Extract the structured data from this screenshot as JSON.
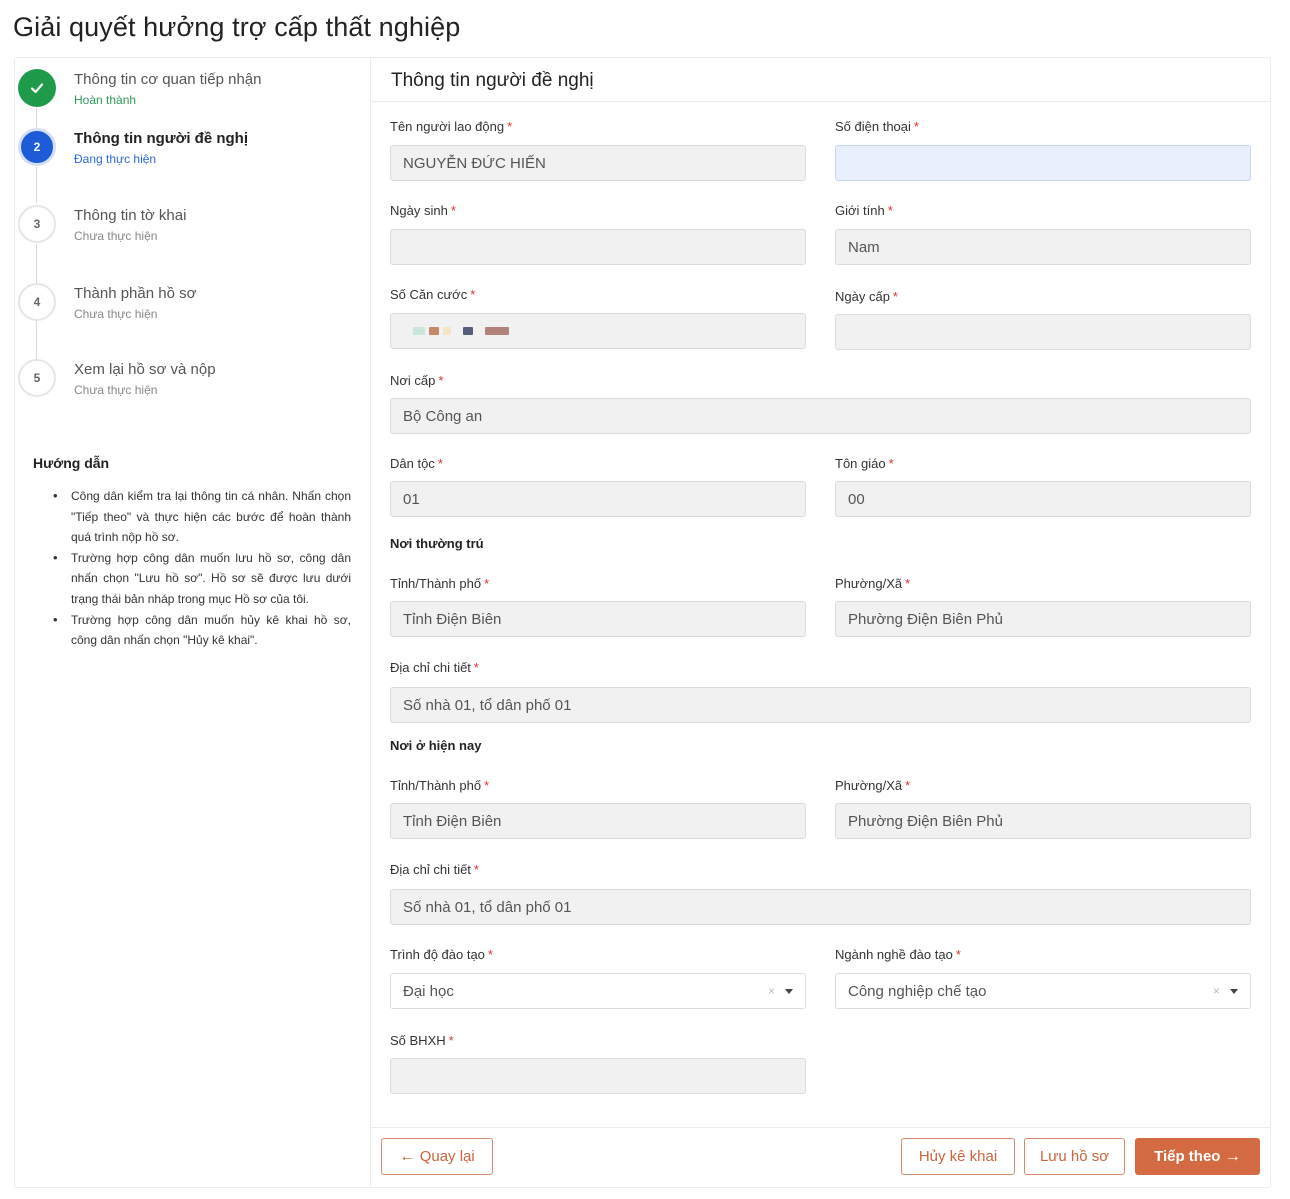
{
  "page": {
    "title": "Giải quyết hưởng trợ cấp thất nghiệp"
  },
  "steps": [
    {
      "number": "1",
      "title": "Thông tin cơ quan tiếp nhận",
      "status": "Hoàn thành",
      "state": "done",
      "icon": "check-icon"
    },
    {
      "number": "2",
      "title": "Thông tin người đề nghị",
      "status": "Đang thực hiện",
      "state": "active"
    },
    {
      "number": "3",
      "title": "Thông tin tờ khai",
      "status": "Chưa thực hiện",
      "state": "todo"
    },
    {
      "number": "4",
      "title": "Thành phần hồ sơ",
      "status": "Chưa thực hiện",
      "state": "todo"
    },
    {
      "number": "5",
      "title": "Xem lại hồ sơ và nộp",
      "status": "Chưa thực hiện",
      "state": "todo"
    }
  ],
  "guide": {
    "title": "Hướng dẫn",
    "items": [
      "Công dân kiểm tra lại thông tin cá nhân. Nhấn chọn \"Tiếp theo\" và thực hiện các bước để hoàn thành quá trình nộp hồ sơ.",
      "Trường hợp công dân muốn lưu hồ sơ, công dân nhấn chọn \"Lưu hồ sơ\". Hồ sơ sẽ được lưu dưới trạng thái bản nháp trong mục Hồ sơ của tôi.",
      "Trường hợp công dân muốn hủy kê khai hồ sơ, công dân nhấn chọn \"Hủy kê khai\"."
    ]
  },
  "form": {
    "title": "Thông tin người đề nghị",
    "required_mark": "*",
    "fields": {
      "ho_ten": {
        "label": "Tên người lao động",
        "value": "NGUYỄN ĐỨC HIẾN"
      },
      "so_dien_thoai": {
        "label": "Số điện thoại",
        "value": ""
      },
      "ngay_sinh": {
        "label": "Ngày sinh",
        "value": ""
      },
      "gioi_tinh": {
        "label": "Giới tính",
        "value": "Nam"
      },
      "so_can_cuoc": {
        "label": "Số Căn cước",
        "value": ""
      },
      "ngay_cap": {
        "label": "Ngày cấp",
        "value": ""
      },
      "noi_cap": {
        "label": "Nơi cấp",
        "value": "Bộ Công an"
      },
      "dan_toc": {
        "label": "Dân tộc",
        "value": "01"
      },
      "ton_giao": {
        "label": "Tôn giáo",
        "value": "00"
      },
      "thuong_tru_tinh": {
        "label": "Tỉnh/Thành phố",
        "value": "Tỉnh Điện Biên"
      },
      "thuong_tru_xa": {
        "label": "Phường/Xã",
        "value": "Phường Điện Biên Phủ"
      },
      "thuong_tru_dia_chi": {
        "label": "Địa chỉ chi tiết",
        "value": "Số nhà 01, tổ dân phố 01"
      },
      "hien_nay_tinh": {
        "label": "Tỉnh/Thành phố",
        "value": "Tỉnh Điện Biên"
      },
      "hien_nay_xa": {
        "label": "Phường/Xã",
        "value": "Phường Điện Biên Phủ"
      },
      "hien_nay_dia_chi": {
        "label": "Địa chỉ chi tiết",
        "value": "Số nhà 01, tổ dân phố 01"
      },
      "trinh_do": {
        "label": "Trình độ đào tạo",
        "value": "Đại học",
        "clear": "×"
      },
      "nganh_nghe": {
        "label": "Ngành nghề đào tạo",
        "value": "Công nghiệp chế tạo",
        "clear": "×"
      },
      "so_bhxh": {
        "label": "Số BHXH",
        "value": ""
      }
    },
    "sections": {
      "thuong_tru": "Nơi thường trú",
      "hien_nay": "Nơi ở hiện nay"
    }
  },
  "actions": {
    "back": "Quay lại",
    "cancel": "Hủy kê khai",
    "save": "Lưu hồ sơ",
    "next": "Tiếp theo"
  },
  "colors": {
    "primary": "#d46a42",
    "done": "#1f9a4b",
    "active": "#1e5bd8",
    "required": "#e0322c"
  }
}
